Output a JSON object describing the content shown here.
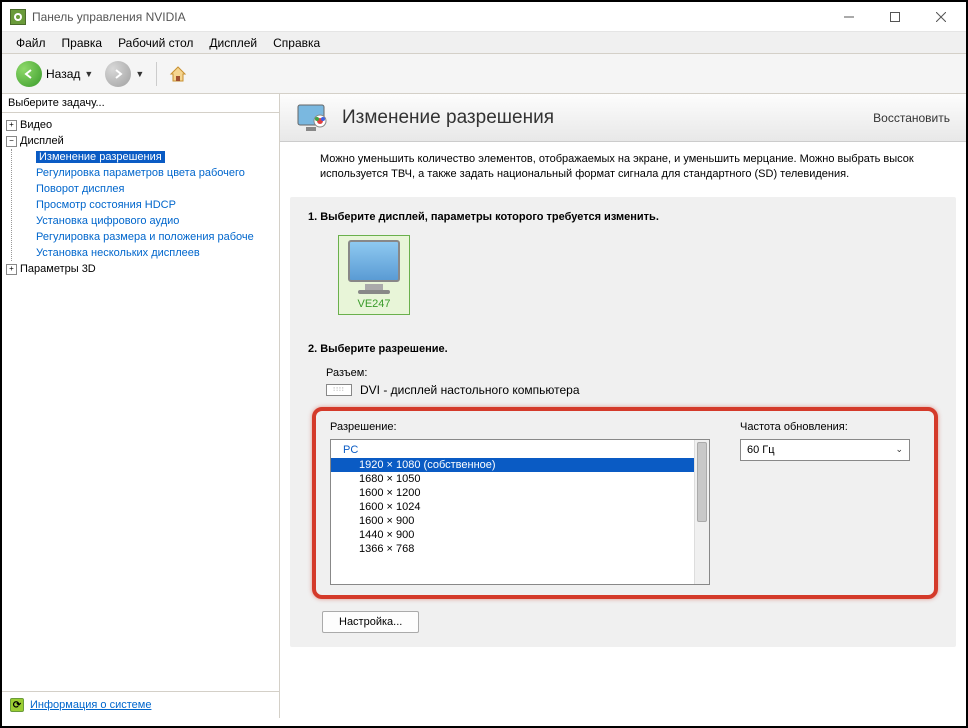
{
  "window": {
    "title": "Панель управления NVIDIA"
  },
  "menu": {
    "file": "Файл",
    "edit": "Правка",
    "desktop": "Рабочий стол",
    "display": "Дисплей",
    "help": "Справка"
  },
  "toolbar": {
    "back": "Назад"
  },
  "sidebar": {
    "header": "Выберите задачу...",
    "video": "Видео",
    "display": "Дисплей",
    "items": {
      "change_res": "Изменение разрешения",
      "adjust_color": "Регулировка параметров цвета рабочего",
      "rotate": "Поворот дисплея",
      "hdcp": "Просмотр состояния HDCP",
      "digital_audio": "Установка цифрового аудио",
      "size_pos": "Регулировка размера и положения рабоче",
      "multi": "Установка нескольких дисплеев"
    },
    "params3d": "Параметры 3D",
    "sysinfo": "Информация о системе"
  },
  "main": {
    "title": "Изменение разрешения",
    "restore": "Восстановить",
    "desc": "Можно уменьшить количество элементов, отображаемых на экране, и уменьшить мерцание. Можно выбрать высок используется ТВЧ, а также задать национальный формат сигнала для стандартного (SD) телевидения.",
    "step1": "1. Выберите дисплей, параметры которого требуется изменить.",
    "monitor": "VE247",
    "step2": "2. Выберите разрешение.",
    "connector_label": "Разъем:",
    "connector_value": "DVI - дисплей настольного компьютера",
    "resolution_label": "Разрешение:",
    "refresh_label": "Частота обновления:",
    "refresh_value": "60 Гц",
    "pc_group": "PC",
    "resolutions": [
      "1920 × 1080 (собственное)",
      "1680 × 1050",
      "1600 × 1200",
      "1600 × 1024",
      "1600 × 900",
      "1440 × 900",
      "1366 × 768"
    ],
    "customize": "Настройка..."
  }
}
